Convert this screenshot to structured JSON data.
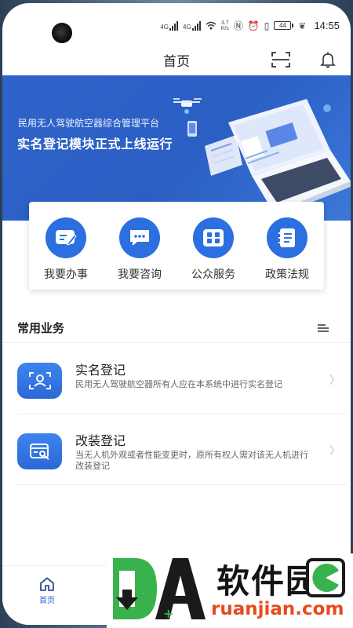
{
  "status": {
    "net_1": "4G",
    "net_2": "4G",
    "speed": "3.7",
    "speed_unit": "K/s",
    "battery": "44",
    "time": "14:55"
  },
  "header": {
    "title": "首页"
  },
  "banner": {
    "subtitle": "民用无人驾驶航空器综合管理平台",
    "headline": "实名登记模块正式上线运行"
  },
  "quick_actions": [
    {
      "label": "我要办事",
      "icon": "form-edit-icon"
    },
    {
      "label": "我要咨询",
      "icon": "chat-bubble-icon"
    },
    {
      "label": "公众服务",
      "icon": "grid-apps-icon"
    },
    {
      "label": "政策法规",
      "icon": "document-icon"
    }
  ],
  "section": {
    "title": "常用业务"
  },
  "services": [
    {
      "name": "实名登记",
      "desc": "民用无人驾驶航空器所有人应在本系统中进行实名登记",
      "icon": "id-scan-icon"
    },
    {
      "name": "改装登记",
      "desc": "当无人机外观或者性能变更时，原所有权人需对该无人机进行改装登记",
      "icon": "modify-card-icon"
    }
  ],
  "tabbar": {
    "home_label": "首页"
  },
  "watermark": {
    "cn": "软件园",
    "en": "ruanjian.com"
  },
  "colors": {
    "primary": "#2b68d6",
    "banner": "#2f63c9",
    "watermark_green": "#37b24d",
    "watermark_orange": "#e84a1c"
  }
}
